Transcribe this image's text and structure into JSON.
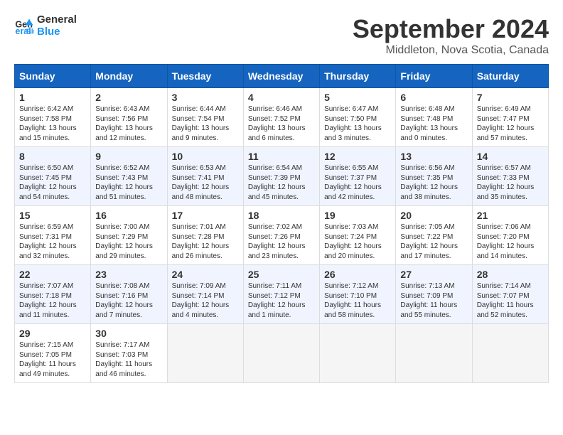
{
  "header": {
    "logo_line1": "General",
    "logo_line2": "Blue",
    "month_title": "September 2024",
    "subtitle": "Middleton, Nova Scotia, Canada"
  },
  "days_of_week": [
    "Sunday",
    "Monday",
    "Tuesday",
    "Wednesday",
    "Thursday",
    "Friday",
    "Saturday"
  ],
  "weeks": [
    [
      {
        "day": "1",
        "info": "Sunrise: 6:42 AM\nSunset: 7:58 PM\nDaylight: 13 hours\nand 15 minutes."
      },
      {
        "day": "2",
        "info": "Sunrise: 6:43 AM\nSunset: 7:56 PM\nDaylight: 13 hours\nand 12 minutes."
      },
      {
        "day": "3",
        "info": "Sunrise: 6:44 AM\nSunset: 7:54 PM\nDaylight: 13 hours\nand 9 minutes."
      },
      {
        "day": "4",
        "info": "Sunrise: 6:46 AM\nSunset: 7:52 PM\nDaylight: 13 hours\nand 6 minutes."
      },
      {
        "day": "5",
        "info": "Sunrise: 6:47 AM\nSunset: 7:50 PM\nDaylight: 13 hours\nand 3 minutes."
      },
      {
        "day": "6",
        "info": "Sunrise: 6:48 AM\nSunset: 7:48 PM\nDaylight: 13 hours\nand 0 minutes."
      },
      {
        "day": "7",
        "info": "Sunrise: 6:49 AM\nSunset: 7:47 PM\nDaylight: 12 hours\nand 57 minutes."
      }
    ],
    [
      {
        "day": "8",
        "info": "Sunrise: 6:50 AM\nSunset: 7:45 PM\nDaylight: 12 hours\nand 54 minutes."
      },
      {
        "day": "9",
        "info": "Sunrise: 6:52 AM\nSunset: 7:43 PM\nDaylight: 12 hours\nand 51 minutes."
      },
      {
        "day": "10",
        "info": "Sunrise: 6:53 AM\nSunset: 7:41 PM\nDaylight: 12 hours\nand 48 minutes."
      },
      {
        "day": "11",
        "info": "Sunrise: 6:54 AM\nSunset: 7:39 PM\nDaylight: 12 hours\nand 45 minutes."
      },
      {
        "day": "12",
        "info": "Sunrise: 6:55 AM\nSunset: 7:37 PM\nDaylight: 12 hours\nand 42 minutes."
      },
      {
        "day": "13",
        "info": "Sunrise: 6:56 AM\nSunset: 7:35 PM\nDaylight: 12 hours\nand 38 minutes."
      },
      {
        "day": "14",
        "info": "Sunrise: 6:57 AM\nSunset: 7:33 PM\nDaylight: 12 hours\nand 35 minutes."
      }
    ],
    [
      {
        "day": "15",
        "info": "Sunrise: 6:59 AM\nSunset: 7:31 PM\nDaylight: 12 hours\nand 32 minutes."
      },
      {
        "day": "16",
        "info": "Sunrise: 7:00 AM\nSunset: 7:29 PM\nDaylight: 12 hours\nand 29 minutes."
      },
      {
        "day": "17",
        "info": "Sunrise: 7:01 AM\nSunset: 7:28 PM\nDaylight: 12 hours\nand 26 minutes."
      },
      {
        "day": "18",
        "info": "Sunrise: 7:02 AM\nSunset: 7:26 PM\nDaylight: 12 hours\nand 23 minutes."
      },
      {
        "day": "19",
        "info": "Sunrise: 7:03 AM\nSunset: 7:24 PM\nDaylight: 12 hours\nand 20 minutes."
      },
      {
        "day": "20",
        "info": "Sunrise: 7:05 AM\nSunset: 7:22 PM\nDaylight: 12 hours\nand 17 minutes."
      },
      {
        "day": "21",
        "info": "Sunrise: 7:06 AM\nSunset: 7:20 PM\nDaylight: 12 hours\nand 14 minutes."
      }
    ],
    [
      {
        "day": "22",
        "info": "Sunrise: 7:07 AM\nSunset: 7:18 PM\nDaylight: 12 hours\nand 11 minutes."
      },
      {
        "day": "23",
        "info": "Sunrise: 7:08 AM\nSunset: 7:16 PM\nDaylight: 12 hours\nand 7 minutes."
      },
      {
        "day": "24",
        "info": "Sunrise: 7:09 AM\nSunset: 7:14 PM\nDaylight: 12 hours\nand 4 minutes."
      },
      {
        "day": "25",
        "info": "Sunrise: 7:11 AM\nSunset: 7:12 PM\nDaylight: 12 hours\nand 1 minute."
      },
      {
        "day": "26",
        "info": "Sunrise: 7:12 AM\nSunset: 7:10 PM\nDaylight: 11 hours\nand 58 minutes."
      },
      {
        "day": "27",
        "info": "Sunrise: 7:13 AM\nSunset: 7:09 PM\nDaylight: 11 hours\nand 55 minutes."
      },
      {
        "day": "28",
        "info": "Sunrise: 7:14 AM\nSunset: 7:07 PM\nDaylight: 11 hours\nand 52 minutes."
      }
    ],
    [
      {
        "day": "29",
        "info": "Sunrise: 7:15 AM\nSunset: 7:05 PM\nDaylight: 11 hours\nand 49 minutes."
      },
      {
        "day": "30",
        "info": "Sunrise: 7:17 AM\nSunset: 7:03 PM\nDaylight: 11 hours\nand 46 minutes."
      },
      null,
      null,
      null,
      null,
      null
    ]
  ]
}
